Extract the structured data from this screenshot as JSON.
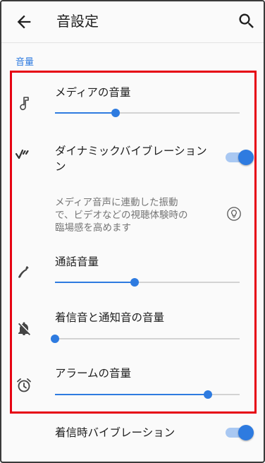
{
  "app_bar": {
    "title": "音設定",
    "back_icon": "arrow-left-icon",
    "search_icon": "search-icon"
  },
  "section": {
    "header": "音量"
  },
  "items": {
    "media_volume": {
      "label": "メディアの音量",
      "icon": "music-note-icon",
      "level": 0.33
    },
    "dynamic_vibration": {
      "label": "ダイナミックバイブレーション\nン",
      "description": "メディア音声に連動した振動\nで、ビデオなどの視聴体験時の\n臨場感を高めます",
      "icon": "vibration-icon",
      "toggle_on": true
    },
    "call_volume": {
      "label": "通話音量",
      "icon": "phone-icon",
      "level": 0.43
    },
    "ring_volume": {
      "label": "着信音と通知音の音量",
      "icon": "bell-off-icon",
      "level": 0.0
    },
    "alarm_volume": {
      "label": "アラームの音量",
      "icon": "alarm-icon",
      "level": 0.83
    },
    "ring_vibration": {
      "label": "着信時バイブレーション",
      "toggle_on": true
    }
  },
  "colors": {
    "accent": "#2e7be0",
    "highlight_box": "#e60012",
    "track": "#d3d3d3"
  }
}
